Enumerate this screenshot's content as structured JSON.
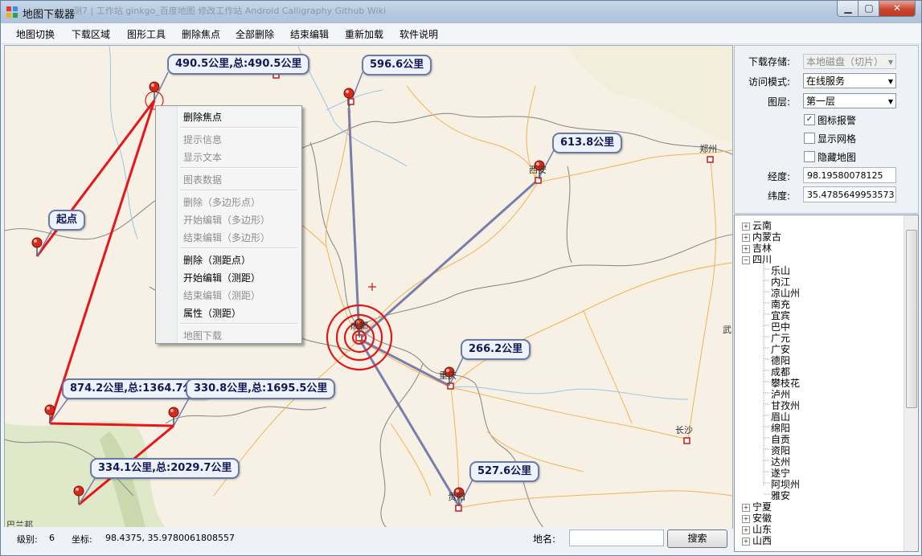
{
  "window": {
    "title": "地图下载器",
    "ghost_taskbar": "测7 | 工作站    ginkgo_百度地图    修改工作站 Android    Calligraphy    Github Wiki"
  },
  "menu": [
    "地图切换",
    "下载区域",
    "图形工具",
    "删除焦点",
    "全部删除",
    "结束编辑",
    "重新加载",
    "软件说明"
  ],
  "map": {
    "callouts": [
      "490.5公里,总:490.5公里",
      "596.6公里",
      "613.8公里",
      "起点",
      "266.2公里",
      "874.2公里,总:1364.7公里",
      "330.8公里,总:1695.5公里",
      "334.1公里,总:2029.7公里",
      "527.6公里"
    ],
    "cities": [
      "郑州",
      "西安",
      "重庆",
      "成都",
      "贵阳",
      "长沙",
      "武",
      "巴兰邦"
    ],
    "colors": {
      "route_red": "#e8151a",
      "route_blue": "#7a7dab",
      "ring": "#e01818"
    }
  },
  "context_menu": {
    "items": [
      {
        "label": "删除焦点",
        "enabled": true
      },
      {
        "label": "提示信息",
        "enabled": false
      },
      {
        "label": "显示文本",
        "enabled": false
      },
      {
        "label": "图表数据",
        "enabled": false
      },
      {
        "label": "删除（多边形点）",
        "enabled": false
      },
      {
        "label": "开始编辑（多边形）",
        "enabled": false
      },
      {
        "label": "结束编辑（多边形）",
        "enabled": false
      },
      {
        "label": "删除（测距点）",
        "enabled": true
      },
      {
        "label": "开始编辑（测距）",
        "enabled": true
      },
      {
        "label": "结束编辑（测距）",
        "enabled": false
      },
      {
        "label": "属性（测距）",
        "enabled": true
      },
      {
        "label": "地图下载",
        "enabled": false
      }
    ]
  },
  "status": {
    "level_label": "级别:",
    "level_value": "6",
    "coord_label": "坐标:",
    "coord_value": "98.4375, 35.9780061808557",
    "place_label": "地名:",
    "place_value": "",
    "search_label": "搜索"
  },
  "panel": {
    "storage_label": "下载存储:",
    "storage_value": "本地磁盘（切片）",
    "access_label": "访问模式:",
    "access_value": "在线服务",
    "layer_label": "图层:",
    "layer_value": "第一层",
    "checks": [
      {
        "label": "图标报警",
        "checked": true
      },
      {
        "label": "显示网格",
        "checked": false
      },
      {
        "label": "隐藏地图",
        "checked": false
      }
    ],
    "lon_label": "经度:",
    "lon_value": "98.19580078125",
    "lat_label": "纬度:",
    "lat_value": "35.4785649953573"
  },
  "tree": {
    "top": [
      {
        "label": "云南",
        "expander": "+"
      },
      {
        "label": "内蒙古",
        "expander": "+"
      },
      {
        "label": "吉林",
        "expander": "+"
      },
      {
        "label": "四川",
        "expander": "−"
      }
    ],
    "sichuan_children": [
      "乐山",
      "内江",
      "凉山州",
      "南充",
      "宜宾",
      "巴中",
      "广元",
      "广安",
      "德阳",
      "成都",
      "攀枝花",
      "泸州",
      "甘孜州",
      "眉山",
      "绵阳",
      "自贡",
      "资阳",
      "达州",
      "遂宁",
      "阿坝州",
      "雅安"
    ],
    "bottom": [
      {
        "label": "宁夏",
        "expander": "+"
      },
      {
        "label": "安徽",
        "expander": "+"
      },
      {
        "label": "山东",
        "expander": "+"
      },
      {
        "label": "山西",
        "expander": "+"
      }
    ]
  }
}
